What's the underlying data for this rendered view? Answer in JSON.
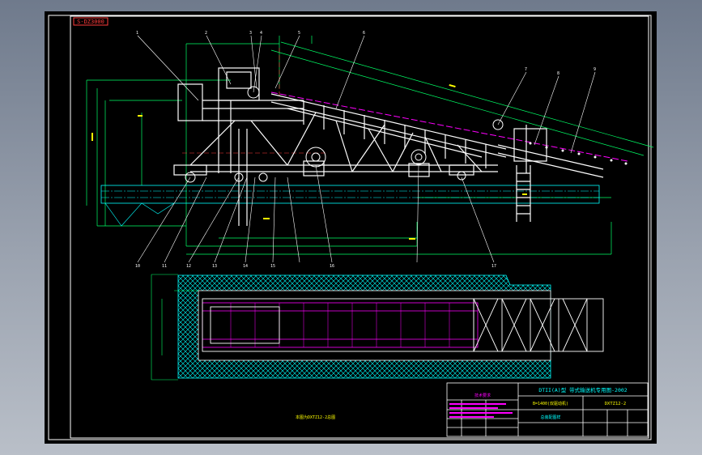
{
  "drawing": {
    "sheet_code": "S-DZ3000",
    "side_view_caption": "",
    "plan_view_caption": "本图为DXTZ12-2总图",
    "title_block": {
      "main_title": "DTII(A)型 带式输送机专用图-2002",
      "drawing_name": "B=1400(双驱动机)",
      "drawing_number": "DXTZ12-2",
      "subtitle": "总装配图样",
      "notes_title": "技术要求"
    },
    "callouts": [
      "1",
      "2",
      "3",
      "4",
      "5",
      "6",
      "7",
      "8",
      "9",
      "10",
      "11",
      "12",
      "13",
      "14",
      "15",
      "16",
      "17"
    ],
    "colors": {
      "frame": "#ffffff",
      "dimension": "#00ff66",
      "centerline": "#ff3b3b",
      "hatch": "#00ffff",
      "belt": "#ff00ff",
      "title_text": "#00ffff",
      "notes_text": "#ff00ff",
      "dim_text": "#ffff00"
    }
  }
}
